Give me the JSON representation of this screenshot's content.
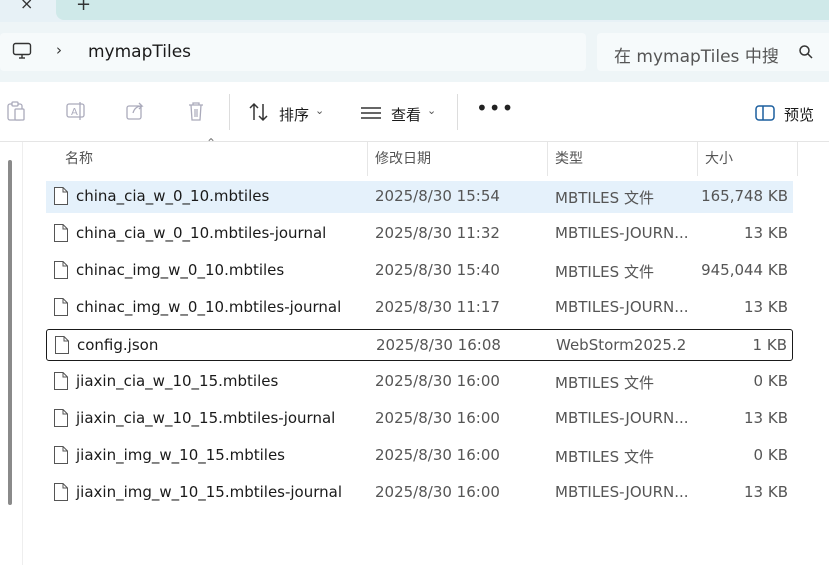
{
  "tabs": {
    "close_glyph": "×",
    "new_tab_glyph": "+"
  },
  "address": {
    "breadcrumb": "mymapTiles",
    "search_placeholder": "在 mymapTiles 中搜索"
  },
  "toolbar": {
    "sort_label": "排序",
    "view_label": "查看",
    "more_label": "•••",
    "preview_label": "预览"
  },
  "columns": {
    "name": "名称",
    "modified": "修改日期",
    "type": "类型",
    "size": "大小"
  },
  "files": [
    {
      "name": "china_cia_w_0_10.mbtiles",
      "date": "2025/8/30 15:54",
      "type": "MBTILES 文件",
      "size": "165,748 KB"
    },
    {
      "name": "china_cia_w_0_10.mbtiles-journal",
      "date": "2025/8/30 11:32",
      "type": "MBTILES-JOURN...",
      "size": "13 KB"
    },
    {
      "name": "chinac_img_w_0_10.mbtiles",
      "date": "2025/8/30 15:40",
      "type": "MBTILES 文件",
      "size": "945,044 KB"
    },
    {
      "name": "chinac_img_w_0_10.mbtiles-journal",
      "date": "2025/8/30 11:17",
      "type": "MBTILES-JOURN...",
      "size": "13 KB"
    },
    {
      "name": "config.json",
      "date": "2025/8/30 16:08",
      "type": "WebStorm2025.2",
      "size": "1 KB"
    },
    {
      "name": "jiaxin_cia_w_10_15.mbtiles",
      "date": "2025/8/30 16:00",
      "type": "MBTILES 文件",
      "size": "0 KB"
    },
    {
      "name": "jiaxin_cia_w_10_15.mbtiles-journal",
      "date": "2025/8/30 16:00",
      "type": "MBTILES-JOURN...",
      "size": "13 KB"
    },
    {
      "name": "jiaxin_img_w_10_15.mbtiles",
      "date": "2025/8/30 16:00",
      "type": "MBTILES 文件",
      "size": "0 KB"
    },
    {
      "name": "jiaxin_img_w_10_15.mbtiles-journal",
      "date": "2025/8/30 16:00",
      "type": "MBTILES-JOURN...",
      "size": "13 KB"
    }
  ]
}
